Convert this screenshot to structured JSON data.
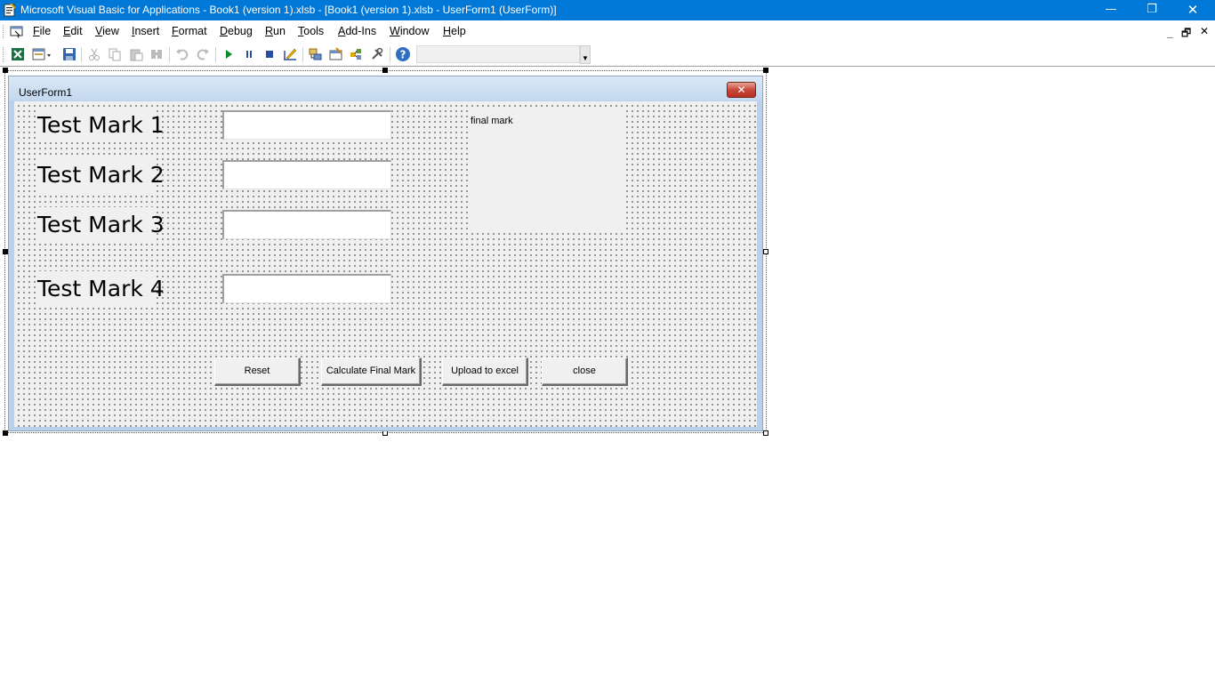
{
  "window": {
    "title": "Microsoft Visual Basic for Applications - Book1 (version 1).xlsb - [Book1 (version 1).xlsb - UserForm1 (UserForm)]",
    "minimize_glyph": "—",
    "maximize_glyph": "❐",
    "close_glyph": "✕"
  },
  "menu": {
    "items": [
      "File",
      "Edit",
      "View",
      "Insert",
      "Format",
      "Debug",
      "Run",
      "Tools",
      "Add-Ins",
      "Window",
      "Help"
    ],
    "mdi_minimize": "_",
    "mdi_restore": "🗗",
    "mdi_close": "✕"
  },
  "toolbar": {
    "buttons": [
      "excel-view-icon",
      "insert-userform-icon",
      "save-icon",
      "cut-icon",
      "copy-icon",
      "paste-icon",
      "find-icon",
      "undo-icon",
      "redo-icon",
      "run-icon",
      "break-icon",
      "reset-icon",
      "design-mode-icon",
      "project-explorer-icon",
      "properties-window-icon",
      "object-browser-icon",
      "toolbox-icon",
      "help-icon"
    ],
    "location_text": ""
  },
  "userform": {
    "caption": "UserForm1",
    "close_glyph": "✕",
    "labels": [
      "Test Mark 1",
      "Test Mark 2",
      "Test Mark 3",
      "Test Mark 4"
    ],
    "inputs": [
      "",
      "",
      "",
      ""
    ],
    "final_mark_label": "final mark",
    "buttons": {
      "reset": "Reset",
      "calculate": "Calculate Final Mark",
      "upload": "Upload to excel",
      "close": "close"
    }
  },
  "colors": {
    "titlebar": "#0078d7",
    "form_background": "#f0f0f0",
    "form_frame": "#b9d1ea"
  }
}
